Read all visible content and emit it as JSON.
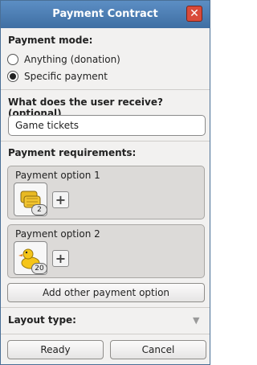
{
  "window": {
    "title": "Payment Contract"
  },
  "payment_mode": {
    "label": "Payment mode:",
    "options": [
      {
        "label": "Anything (donation)",
        "selected": false
      },
      {
        "label": "Specific payment",
        "selected": true
      }
    ]
  },
  "receive": {
    "label": "What does the user receive? (optional)",
    "value": "Game tickets"
  },
  "requirements": {
    "label": "Payment requirements:",
    "options": [
      {
        "label": "Payment option 1",
        "item_icon": "hay-bale-icon",
        "count": "2"
      },
      {
        "label": "Payment option 2",
        "item_icon": "rubber-duck-icon",
        "count": "20"
      }
    ],
    "add_label": "Add other payment option"
  },
  "layout": {
    "label": "Layout type:",
    "icon": "chevron-down-icon"
  },
  "buttons": {
    "ready": "Ready",
    "cancel": "Cancel"
  },
  "colors": {
    "titlebar": "#4a7db4",
    "close": "#d94b3a",
    "panel": "#f2f1f0"
  }
}
